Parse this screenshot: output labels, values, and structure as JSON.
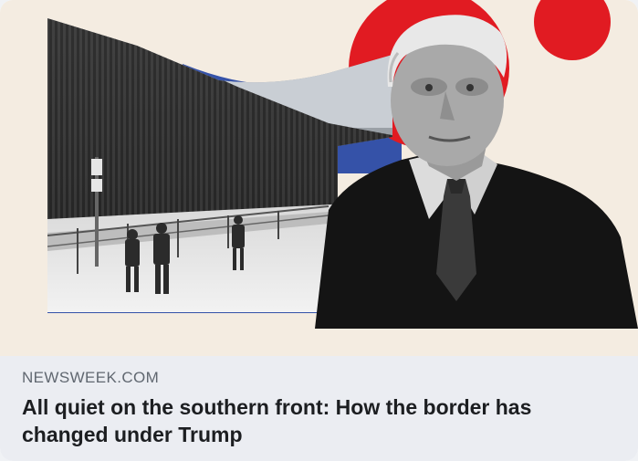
{
  "link_preview": {
    "image_alt": "Border wall with patrolling guards and portrait of Donald Trump",
    "source_domain": "NEWSWEEK.COM",
    "headline": "All quiet on the southern front: How the border has changed under Trump"
  },
  "colors": {
    "background": "#f4ece1",
    "accent_red": "#e11b22",
    "accent_blue": "#3552a8",
    "meta_background": "#ebedf2",
    "domain_text": "#606770",
    "headline_text": "#1c1e21"
  }
}
